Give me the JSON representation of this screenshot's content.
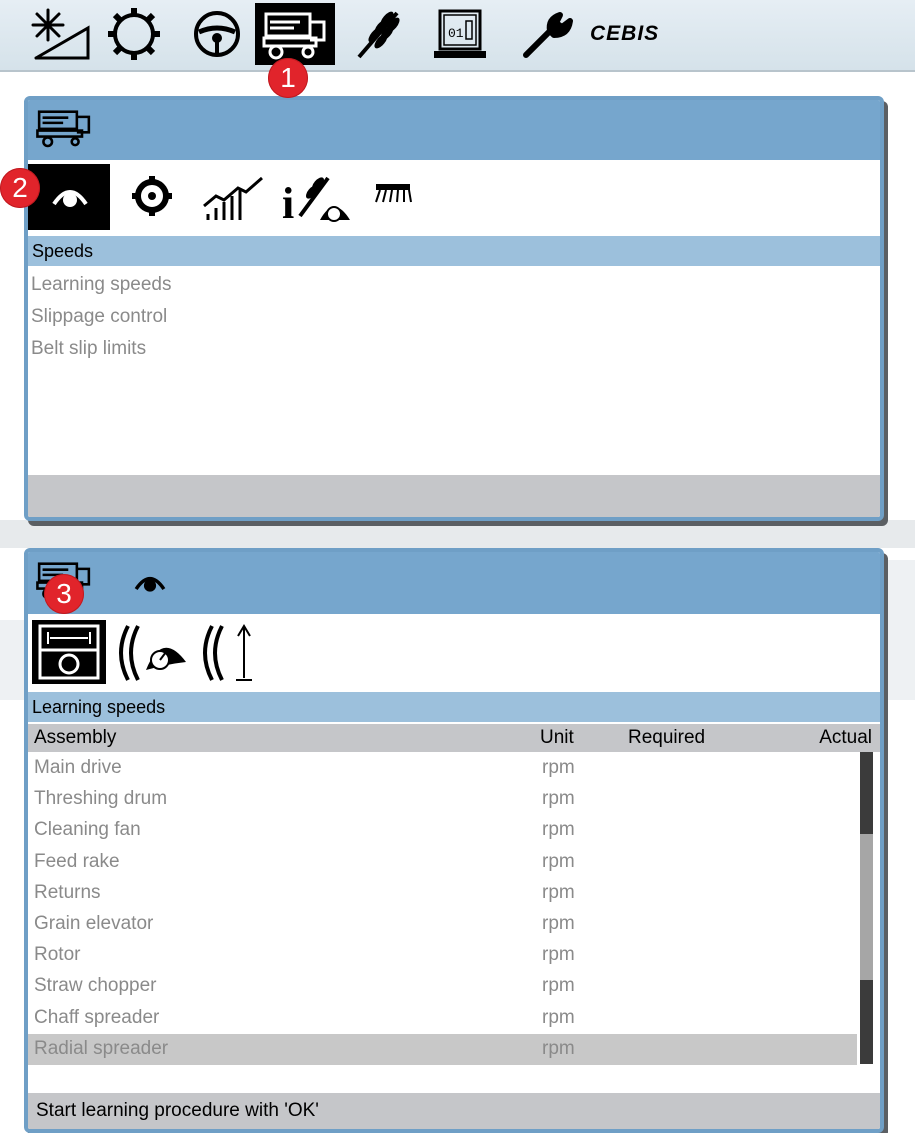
{
  "toolbar": {
    "icons": [
      "sun-slope-icon",
      "gear-ring-icon",
      "steering-wheel-icon",
      "combine-harvester-icon",
      "grain-ear-icon",
      "terminal-display-icon",
      "wrench-icon"
    ],
    "active_icon": "combine-harvester-icon",
    "brand_label": "CEBIS"
  },
  "markers": [
    "1",
    "2",
    "3"
  ],
  "window1": {
    "title_icon": "combine-harvester-icon",
    "tabs": [
      "speedometer-icon",
      "cog-icon",
      "ramp-bars-icon",
      "info-grain-gauge-icon",
      "comb-header-icon"
    ],
    "active_tab": "speedometer-icon",
    "section_title": "Speeds",
    "menu_items": [
      "Learning speeds",
      "Slippage control",
      "Belt slip limits"
    ]
  },
  "window2": {
    "title_icons": [
      "combine-harvester-icon",
      "speedometer-icon"
    ],
    "tabs": [
      "learn-range-icon",
      "drive-gauge-icon",
      "drive-height-icon"
    ],
    "active_tab": "learn-range-icon",
    "section_title": "Learning speeds",
    "table": {
      "headers": [
        "Assembly",
        "Unit",
        "Required",
        "Actual"
      ],
      "rows": [
        {
          "assembly": "Main drive",
          "unit": "rpm"
        },
        {
          "assembly": "Threshing drum",
          "unit": "rpm"
        },
        {
          "assembly": "Cleaning fan",
          "unit": "rpm"
        },
        {
          "assembly": "Feed rake",
          "unit": "rpm"
        },
        {
          "assembly": "Returns",
          "unit": "rpm"
        },
        {
          "assembly": "Grain elevator",
          "unit": "rpm"
        },
        {
          "assembly": "Rotor",
          "unit": "rpm"
        },
        {
          "assembly": "Straw chopper",
          "unit": "rpm"
        },
        {
          "assembly": "Chaff spreader",
          "unit": "rpm"
        },
        {
          "assembly": "Radial spreader",
          "unit": "rpm"
        }
      ],
      "selected_row": "Radial spreader"
    },
    "status_text": "Start learning procedure with 'OK'"
  },
  "colors": {
    "title_bar": "#76a6cd",
    "section_header": "#9cc0dc",
    "marker": "#e1242b",
    "footer": "#c5c6c9"
  }
}
